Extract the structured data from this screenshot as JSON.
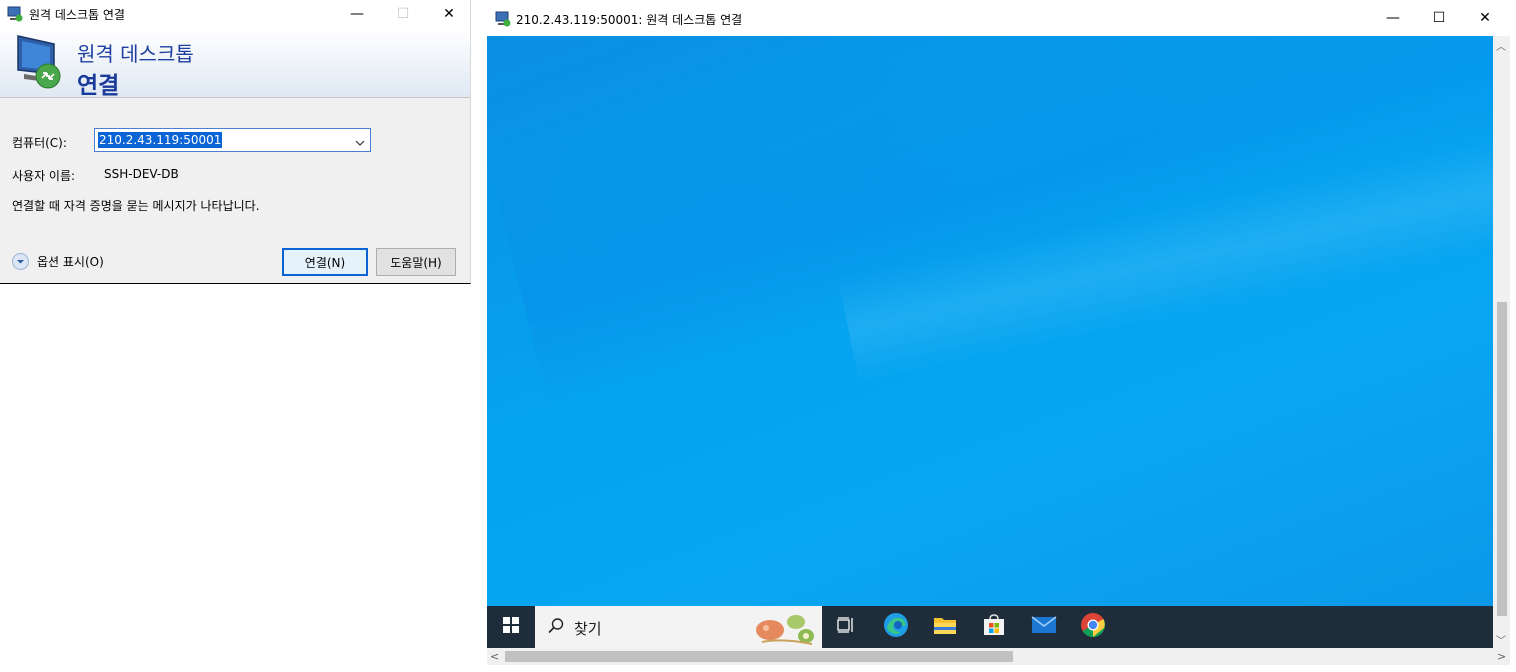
{
  "dialog": {
    "title": "원격 데스크톱 연결",
    "banner_line1": "원격 데스크톱",
    "banner_line2": "연결",
    "computer_label": "컴퓨터(C):",
    "computer_value": "210.2.43.119:50001",
    "username_label": "사용자 이름:",
    "username_value": "SSH-DEV-DB",
    "credential_note": "연결할 때 자격 증명을 묻는 메시지가 나타납니다.",
    "options_label": "옵션 표시(O)",
    "connect_label": "연결(N)",
    "help_label": "도움말(H)",
    "caption_buttons": [
      "minimize-icon",
      "maximize-icon-disabled",
      "close-icon"
    ]
  },
  "session": {
    "title": "210.2.43.119:50001: 원격 데스크톱 연결",
    "caption_buttons": [
      "minimize-icon",
      "maximize-icon",
      "close-icon"
    ],
    "desktop_colors": {
      "wallpaper": "#05a4f0",
      "taskbar": "#1f2d3a"
    },
    "taskbar": {
      "search_text": "찾기",
      "apps": [
        "task-view-icon",
        "edge-icon",
        "file-explorer-icon",
        "store-icon",
        "mail-icon",
        "chrome-icon"
      ]
    }
  }
}
